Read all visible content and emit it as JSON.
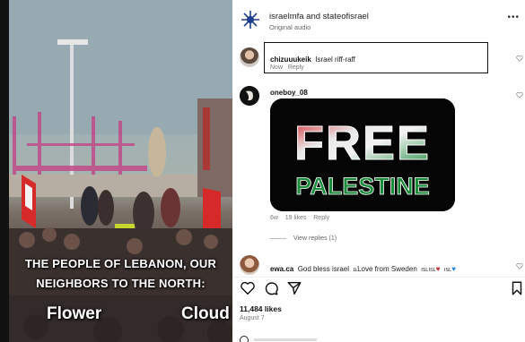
{
  "video": {
    "caption_line1": "THE PEOPLE OF LEBANON, OUR",
    "caption_line2": "NEIGHBORS TO THE NORTH:",
    "word_left": "Flower",
    "word_right": "Cloud"
  },
  "post": {
    "authors": "israelmfa and stateofisrael",
    "audio_label": "Original audio",
    "more_icon": "more-icon"
  },
  "comments": [
    {
      "username": "chizuuukeik",
      "text": "Israel riff-raff",
      "meta_now": "Now",
      "meta_reply": "Reply"
    },
    {
      "username": "oneboy_08",
      "image_words": [
        "FREE",
        "PALESTINE"
      ],
      "meta_age": "6w",
      "meta_likes": "19 likes",
      "meta_reply": "Reply",
      "view_replies": "View replies (1)"
    },
    {
      "username": "ewa.ca",
      "text_a": "God bless israel",
      "text_b": "Love from Sweden",
      "tail_a": "ISLISL",
      "tail_b": "ISL",
      "heart_left": "♥",
      "heart_right": "♥"
    }
  ],
  "actions": {
    "likes": "11,484 likes",
    "date": "August 7"
  },
  "colors": {
    "flag_red": "#d2232a",
    "flag_green": "#1a8a3b",
    "highlight_border": "#111111"
  }
}
